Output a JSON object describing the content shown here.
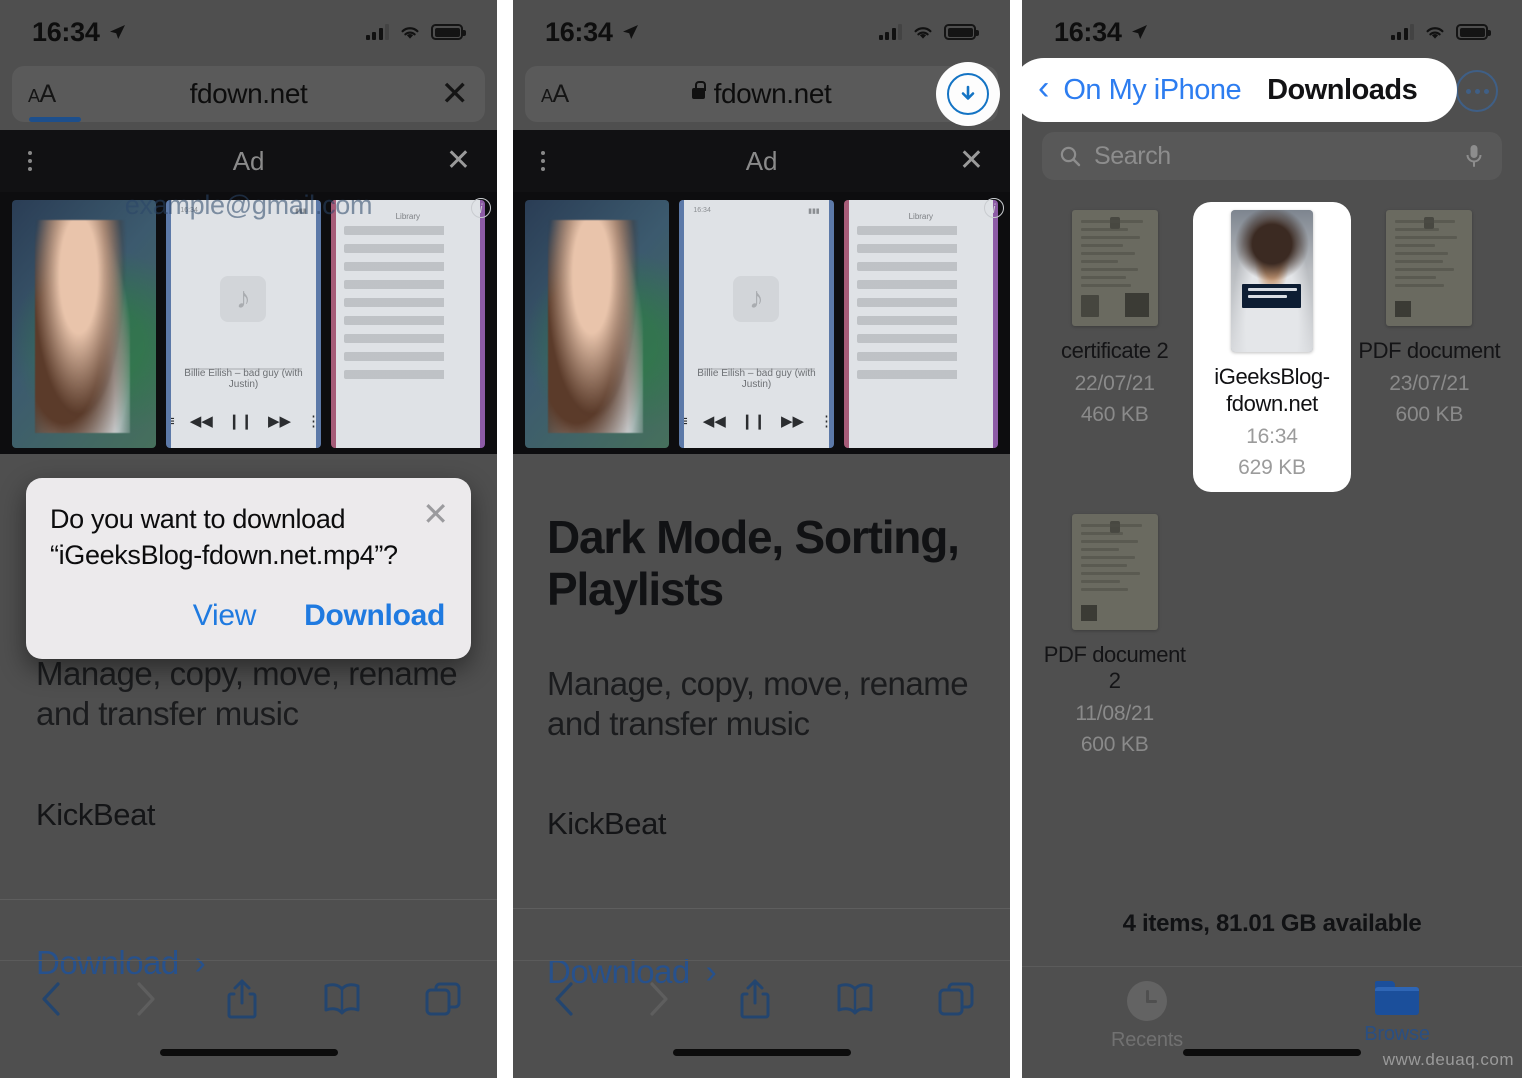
{
  "statusbar": {
    "time": "16:34",
    "location_icon": "location-arrow-icon",
    "signal_icon": "cellular-bars-icon",
    "wifi_icon": "wifi-icon",
    "battery_icon": "battery-icon"
  },
  "panel1": {
    "urlbar": {
      "text_size_label": "AA",
      "url": "fdown.net",
      "close_label": "✕"
    },
    "ad": {
      "label": "Ad",
      "close_label": "✕",
      "menu_icon": "kebab-menu-icon"
    },
    "hero": {
      "ghost_email": "example@gmail.com",
      "info_icon": "ad-info-icon"
    },
    "dialog": {
      "message": "Do you want to download “iGeeksBlog-fdown.net.mp4”?",
      "close_label": "✕",
      "view_label": "View",
      "download_label": "Download"
    },
    "content": {
      "subtitle": "Manage, copy, move, rename and transfer music",
      "brand": "KickBeat",
      "download_link": "Download",
      "chevron": "›"
    },
    "toolbar": {
      "back": "back-chevron-icon",
      "forward": "forward-chevron-icon",
      "share": "share-icon",
      "bookmarks": "bookmarks-icon",
      "tabs": "tabs-icon"
    }
  },
  "panel2": {
    "urlbar": {
      "text_size_label": "AA",
      "url": "fdown.net",
      "lock_icon": "lock-icon",
      "reload_icon": "reload-icon",
      "download_icon": "downloads-arrow-icon"
    },
    "ad": {
      "label": "Ad",
      "close_label": "✕",
      "menu_icon": "kebab-menu-icon"
    },
    "hero": {
      "info_icon": "ad-info-icon"
    },
    "content": {
      "heading": "Dark Mode, Sorting, Playlists",
      "subtitle": "Manage, copy, move, rename and transfer music",
      "brand": "KickBeat",
      "download_link": "Download",
      "chevron": "›"
    },
    "toolbar": {
      "back": "back-chevron-icon",
      "forward": "forward-chevron-icon",
      "share": "share-icon",
      "bookmarks": "bookmarks-icon",
      "tabs": "tabs-icon"
    }
  },
  "panel3": {
    "nav": {
      "back_label": "On My iPhone",
      "title": "Downloads",
      "back_chevron": "‹",
      "more_icon": "more-ellipsis-icon"
    },
    "search": {
      "placeholder": "Search",
      "search_icon": "search-icon",
      "mic_icon": "microphone-icon"
    },
    "files": [
      {
        "name": "certificate 2",
        "date": "22/07/21",
        "size": "460 KB",
        "kind": "document",
        "selected": false
      },
      {
        "name": "iGeeksBlog-fdown.net",
        "date": "16:34",
        "size": "629 KB",
        "kind": "video",
        "selected": true
      },
      {
        "name": "PDF document",
        "date": "23/07/21",
        "size": "600 KB",
        "kind": "document",
        "selected": false
      },
      {
        "name": "PDF document 2",
        "date": "11/08/21",
        "size": "600 KB",
        "kind": "document",
        "selected": false
      }
    ],
    "status": "4 items, 81.01 GB available",
    "tabs": [
      {
        "label": "Recents",
        "icon": "clock-icon",
        "active": false
      },
      {
        "label": "Browse",
        "icon": "folder-icon",
        "active": true
      }
    ]
  },
  "watermark": "www.deuaq.com",
  "colors": {
    "accent_blue": "#2d7df0",
    "link_blue": "#27518c",
    "dim_bg": "#4f4f4f"
  }
}
